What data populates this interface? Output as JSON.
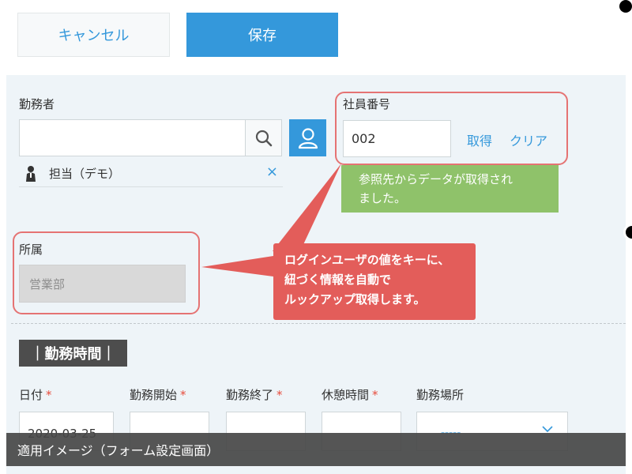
{
  "toolbar": {
    "cancel_label": "キャンセル",
    "save_label": "保存"
  },
  "worker": {
    "label": "勤務者",
    "selected_name": "担当（デモ）",
    "remove_glyph": "×"
  },
  "employee": {
    "label": "社員番号",
    "value": "002",
    "fetch_label": "取得",
    "clear_label": "クリア"
  },
  "lookup_message": {
    "line1": "参照先からデータが取得され",
    "line2": "ました。"
  },
  "department": {
    "label": "所属",
    "value": "営業部"
  },
  "callout": {
    "line1": "ログインユーザの値をキーに、",
    "line2": "紐づく情報を自動で",
    "line3": "ルックアップ取得します。"
  },
  "work_time": {
    "section_title": "｜勤務時間｜",
    "fields": {
      "date": "日付",
      "start": "勤務開始",
      "end": "勤務終了",
      "break": "休憩時間",
      "place": "勤務場所"
    },
    "required_mark": "*",
    "date_value": "2020-03-25",
    "place_value": "-----"
  },
  "caption": "適用イメージ（フォーム設定画面）",
  "icons": {
    "search": "search-icon",
    "user": "user-icon",
    "avatar": "person-avatar-icon",
    "remove": "close-icon",
    "chevron": "chevron-down-icon"
  },
  "colors": {
    "accent": "#3498db",
    "highlight": "#e57373",
    "callout": "#e35d5a",
    "success": "#8fc26a",
    "required": "#e74c3c"
  }
}
